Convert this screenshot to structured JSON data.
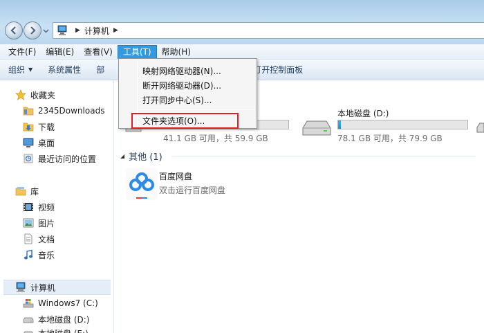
{
  "address": {
    "crumb": "计算机"
  },
  "menubar": [
    "文件(F)",
    "编辑(E)",
    "查看(V)",
    "工具(T)",
    "帮助(H)"
  ],
  "active_menu_index": 3,
  "command_bar": {
    "organize": "组织",
    "system_props": "系统属性",
    "partial": "部",
    "control_panel": "打开控制面板"
  },
  "tools_menu": {
    "items": [
      "映射网络驱动器(N)...",
      "断开网络驱动器(D)...",
      "打开同步中心(S)...",
      "文件夹选项(O)..."
    ],
    "highlighted": "文件夹选项(O)..."
  },
  "sidebar": {
    "favorites": {
      "label": "收藏夹",
      "items": [
        "2345Downloads",
        "下载",
        "桌面",
        "最近访问的位置"
      ]
    },
    "libraries": {
      "label": "库",
      "items": [
        "视频",
        "图片",
        "文档",
        "音乐"
      ]
    },
    "computer": {
      "label": "计算机",
      "items": [
        "Windows7 (C:)",
        "本地磁盘 (D:)",
        "本地磁盘 (E:)"
      ]
    }
  },
  "main": {
    "drives": [
      {
        "name": "",
        "free_text": "41.1 GB 可用，共 59.9 GB",
        "used_fraction": 0.31
      },
      {
        "name": "本地磁盘 (D:)",
        "free_text": "78.1 GB 可用，共 79.9 GB",
        "used_fraction": 0.023
      }
    ],
    "other_group": "其他 (1)",
    "app": {
      "name": "百度网盘",
      "desc": "双击运行百度网盘"
    }
  },
  "colors": {
    "menu_active": "#3399e0",
    "highlight_box": "#e02020",
    "drive_fill": "#26a0dc"
  }
}
